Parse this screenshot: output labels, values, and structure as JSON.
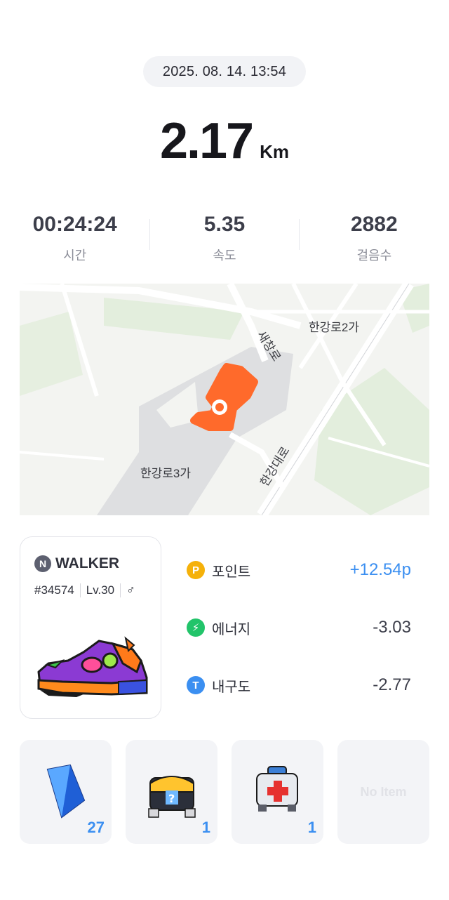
{
  "run": {
    "datetime": "2025. 08. 14. 13:54",
    "distance": "2.17",
    "distance_unit": "Km"
  },
  "stats": [
    {
      "value": "00:24:24",
      "label": "시간"
    },
    {
      "value": "5.35",
      "label": "속도"
    },
    {
      "value": "2882",
      "label": "걸음수"
    }
  ],
  "map": {
    "labels": [
      "새창로",
      "한강로2가",
      "한강로3가",
      "한강대로"
    ],
    "route_color": "#ff6a2b"
  },
  "shoe_card": {
    "brand_badge": "N",
    "brand": "WALKER",
    "id": "#34574",
    "level": "Lv.30",
    "gender_symbol": "♂"
  },
  "rewards": [
    {
      "icon": "point-icon",
      "badge": "P",
      "label": "포인트",
      "value": "+12.54p",
      "color": "#f5b10a"
    },
    {
      "icon": "energy-icon",
      "badge": "⚡",
      "label": "에너지",
      "value": "-3.03",
      "color": "#22c46a"
    },
    {
      "icon": "durability-icon",
      "badge": "T",
      "label": "내구도",
      "value": "-2.77",
      "color": "#3b8ff1"
    }
  ],
  "items": [
    {
      "icon": "blue-gem-icon",
      "count": "27"
    },
    {
      "icon": "mystery-box-icon",
      "count": "1"
    },
    {
      "icon": "repair-kit-icon",
      "count": "1"
    },
    {
      "icon": "empty-slot",
      "empty_label": "No Item"
    }
  ],
  "colors": {
    "accent_blue": "#3b8ff1",
    "route_orange": "#ff6a2b"
  }
}
